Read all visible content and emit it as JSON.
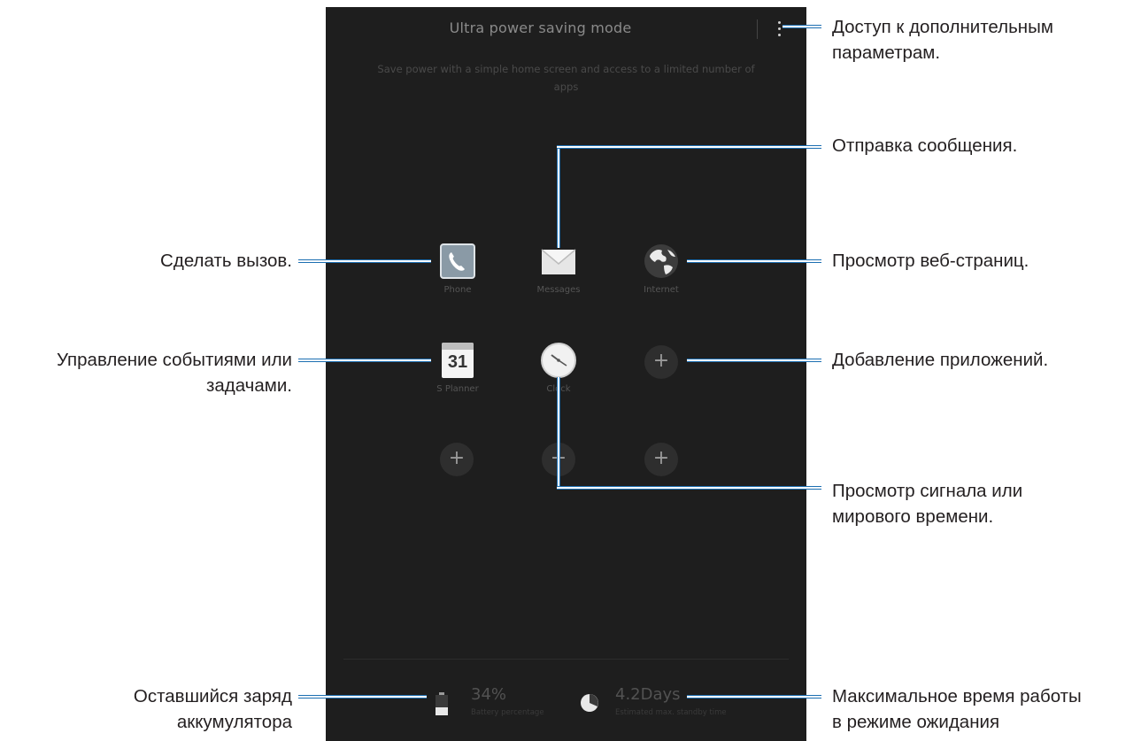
{
  "screen": {
    "title": "Ultra power saving mode",
    "description_line1": "Save power with a simple home screen and access to a limited number of",
    "description_line2": "apps",
    "apps": [
      {
        "label": "Phone"
      },
      {
        "label": "Messages"
      },
      {
        "label": "Internet"
      },
      {
        "label": "S Planner",
        "icon_text": "31"
      },
      {
        "label": "Clock"
      }
    ],
    "add_symbol": "+",
    "battery": {
      "value": "34%",
      "caption": "Battery percentage"
    },
    "standby": {
      "value": "4.2Days",
      "caption": "Estimated max. standby time"
    }
  },
  "callouts": {
    "more_options": [
      "Доступ к дополнительным",
      "параметрам."
    ],
    "send_message": "Отправка сообщения.",
    "make_call": "Сделать вызов.",
    "browse_web": "Просмотр веб-страниц.",
    "manage_events": [
      "Управление событиями или",
      "задачами."
    ],
    "add_apps": "Добавление приложений.",
    "alarm_clock": [
      "Просмотр сигнала или",
      "мирового времени."
    ],
    "battery_left": [
      "Оставшийся заряд",
      "аккумулятора"
    ],
    "standby_time": [
      "Максимальное время работы",
      "в режиме ожидания"
    ]
  },
  "colors": {
    "leader": "#1d6fb2",
    "screen_bg": "#1e1e1e"
  }
}
